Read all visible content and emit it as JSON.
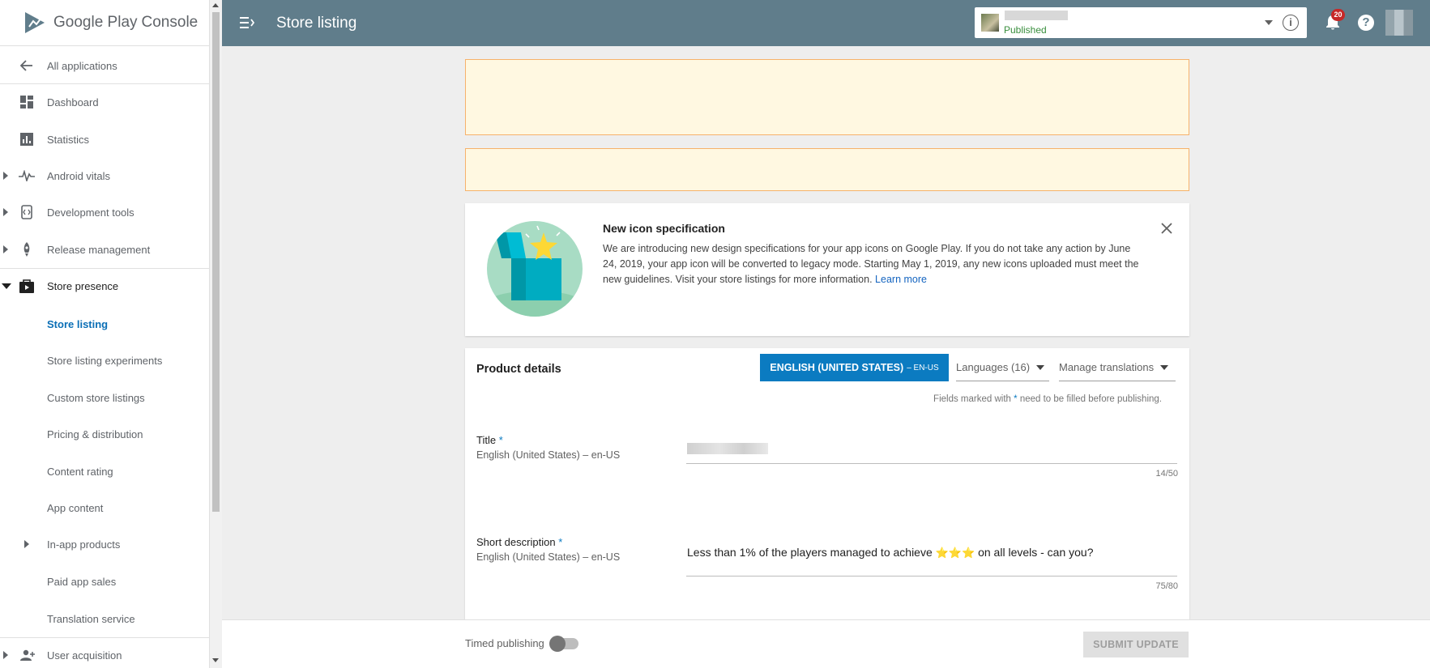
{
  "brand": {
    "name": "Google Play",
    "product": "Console"
  },
  "header": {
    "title": "Store listing",
    "app_status": "Published",
    "notification_count": "20",
    "info_glyph": "i",
    "help_glyph": "?"
  },
  "sidebar": {
    "back_label": "All applications",
    "items": [
      {
        "label": "Dashboard",
        "icon": "dashboard-icon"
      },
      {
        "label": "Statistics",
        "icon": "bar-chart-icon"
      },
      {
        "label": "Android vitals",
        "icon": "pulse-icon"
      },
      {
        "label": "Development tools",
        "icon": "code-icon"
      },
      {
        "label": "Release management",
        "icon": "rocket-icon"
      },
      {
        "label": "Store presence",
        "icon": "shopping-bag-icon"
      },
      {
        "label": "Store listing"
      },
      {
        "label": "Store listing experiments"
      },
      {
        "label": "Custom store listings"
      },
      {
        "label": "Pricing & distribution"
      },
      {
        "label": "Content rating"
      },
      {
        "label": "App content"
      },
      {
        "label": "In-app products"
      },
      {
        "label": "Paid app sales"
      },
      {
        "label": "Translation service"
      },
      {
        "label": "User acquisition",
        "icon": "person-add-icon"
      }
    ]
  },
  "notice": {
    "title": "New icon specification",
    "body": "We are introducing new design specifications for your app icons on Google Play. If you do not take any action by June 24, 2019, your app icon will be converted to legacy mode. Starting May 1, 2019, any new icons uploaded must meet the new guidelines. Visit your store listings for more information.",
    "link": "Learn more"
  },
  "product_details": {
    "title": "Product details",
    "language_button": "ENGLISH (UNITED STATES)",
    "language_code": "– EN-US",
    "languages_dropdown": "Languages (16)",
    "manage_translations": "Manage translations",
    "fields_note_pre": "Fields marked with",
    "fields_note_star": "*",
    "fields_note_post": "need to be filled before publishing.",
    "title_field": {
      "label": "Title",
      "required": "*",
      "sublabel": "English (United States) – en-US",
      "count": "14/50"
    },
    "short_desc_field": {
      "label": "Short description",
      "required": "*",
      "sublabel": "English (United States) – en-US",
      "value_pre": "Less than 1% of the players managed to achieve",
      "value_stars": "⭐⭐⭐",
      "value_post": "on all levels - can you?",
      "count": "75/80"
    }
  },
  "footer": {
    "timed_publishing": "Timed publishing",
    "submit": "SUBMIT UPDATE"
  },
  "colors": {
    "header": "#607d8b",
    "accent": "#0b7bc1",
    "warning_bg": "#fff8e1",
    "warning_border": "#f6b26b",
    "published": "#388e3c"
  }
}
